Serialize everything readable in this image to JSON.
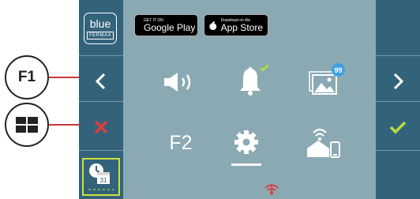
{
  "physical_buttons": {
    "f1_label": "F1"
  },
  "logo": {
    "script_text": "blue",
    "brand": "FERMAX"
  },
  "stores": {
    "google_top": "GET IT ON",
    "google_main": "Google Play",
    "apple_top": "Download on the",
    "apple_main": "App Store"
  },
  "main": {
    "f2_label": "F2",
    "gallery_badge": "99"
  },
  "calendar": {
    "day": "31"
  },
  "colors": {
    "screen_bg": "#8aa9b3",
    "side_bg": "#33637b",
    "accent_red": "#e03c3c",
    "accent_green": "#b9db3a",
    "badge_blue": "#3fa0e0",
    "wifi_red": "#e03c3c"
  },
  "icons": [
    "close-icon",
    "check-icon",
    "chevron-left-icon",
    "chevron-right-icon",
    "speaker-icon",
    "bell-icon",
    "gallery-icon",
    "gear-icon",
    "smart-home-icon",
    "calendar-clock-icon",
    "wifi-icon"
  ]
}
